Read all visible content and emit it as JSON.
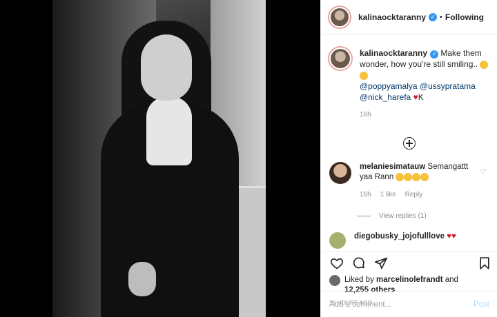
{
  "post": {
    "username": "kalinaocktaranny",
    "following_label": "Following",
    "caption_text": " Make them wonder, how you're still smiling.. ",
    "mentions": [
      "@poppyamalya",
      "@ussypratama",
      "@nick_harefa"
    ],
    "caption_suffix": "K",
    "caption_time": "16h"
  },
  "comments": [
    {
      "username": "melaniesimatauw",
      "text": " Semangattt yaa Rann",
      "time": "16h",
      "likes": "1 like",
      "reply": "Reply",
      "view_replies": "View replies (1)"
    },
    {
      "username": "diegobusky_jojofulllove"
    }
  ],
  "likes": {
    "liked_by_prefix": "Liked by ",
    "liked_by_user": "marcelinolefrandt",
    "and_text": " and",
    "others": "12,255 others"
  },
  "timestamp": "16 HOURS AGO",
  "input": {
    "placeholder": "Add a comment...",
    "post_label": "Post"
  },
  "colors": {
    "accent": "#3897f0",
    "link": "#00376b",
    "heart": "#d11a2a",
    "muted": "#8e8e8e",
    "post_disabled": "#b2dffc"
  }
}
